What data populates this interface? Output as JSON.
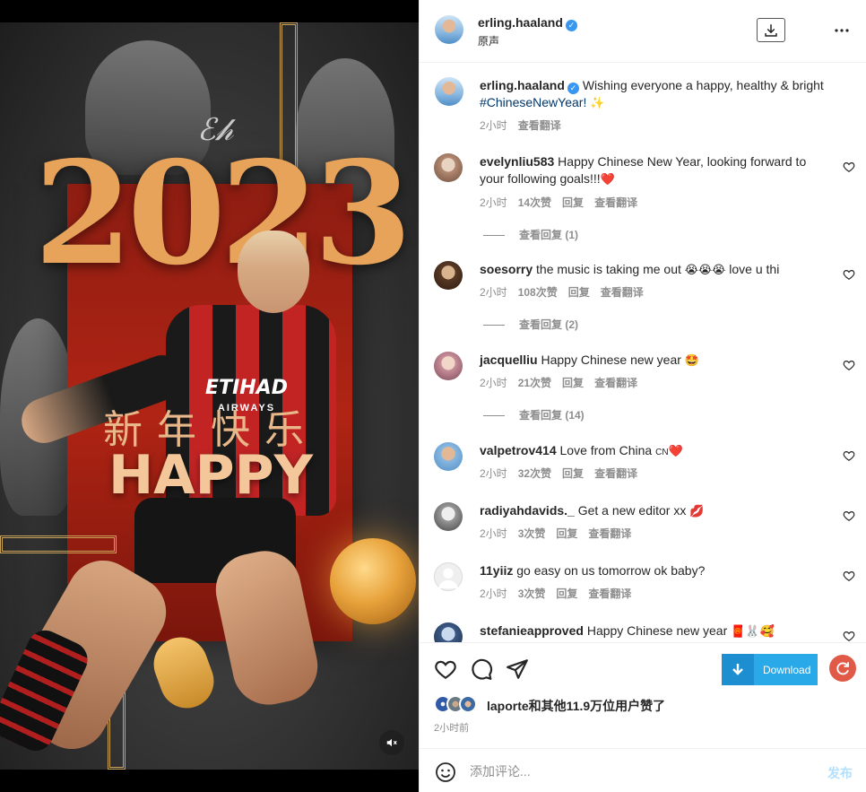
{
  "media": {
    "year_text": "2023",
    "greeting_cn": "新年快乐",
    "greeting_en": "HAPPY",
    "sponsor": "ETIHAD",
    "sponsor_sub": "AIRWAYS",
    "mute_icon": "speaker-muted-icon"
  },
  "header": {
    "username": "erling.haaland",
    "audio_label": "原声",
    "download_icon": "download-tray-icon",
    "more_icon": "more-horizontal-icon"
  },
  "caption": {
    "username": "erling.haaland",
    "text": "Wishing everyone a happy, healthy & bright",
    "hashtag": "#ChineseNewYear!",
    "emoji": "✨",
    "time": "2小时",
    "translate": "查看翻译"
  },
  "comments": [
    {
      "username": "evelynliu583",
      "text": "Happy Chinese New Year, looking forward to your following goals!!!",
      "emoji": "❤️",
      "time": "2小时",
      "likes": "14次赞",
      "reply": "回复",
      "translate": "查看翻译",
      "view_replies": "查看回复 (1)"
    },
    {
      "username": "soesorry",
      "text": "the music is taking me out",
      "emoji": "😭😭😭",
      "text2": "love u thi",
      "time": "2小时",
      "likes": "108次赞",
      "reply": "回复",
      "translate": "查看翻译",
      "view_replies": "查看回复 (2)"
    },
    {
      "username": "jacquelliu",
      "text": "Happy Chinese new year",
      "emoji": "🤩",
      "time": "2小时",
      "likes": "21次赞",
      "reply": "回复",
      "translate": "查看翻译",
      "view_replies": "查看回复 (14)"
    },
    {
      "username": "valpetrov414",
      "text": "Love from China",
      "flag": "CN",
      "emoji": "❤️",
      "time": "2小时",
      "likes": "32次赞",
      "reply": "回复",
      "translate": "查看翻译"
    },
    {
      "username": "radiyahdavids._",
      "text": "Get a new editor xx",
      "emoji": "💋",
      "time": "2小时",
      "likes": "3次赞",
      "reply": "回复",
      "translate": "查看翻译"
    },
    {
      "username": "11yiiz",
      "text": "go easy on us tomorrow ok baby?",
      "time": "2小时",
      "likes": "3次赞",
      "reply": "回复",
      "translate": "查看翻译"
    },
    {
      "username": "stefanieapproved",
      "text": "Happy Chinese new year",
      "emoji": "🧧🐰🥰"
    }
  ],
  "actions": {
    "like_icon": "heart-icon",
    "comment_icon": "comment-bubble-icon",
    "share_icon": "paper-plane-icon",
    "download_label": "Download",
    "refresh_icon": "refresh-icon",
    "likes_text": "laporte和其他11.9万位用户赞了",
    "posted_ago": "2小时前"
  },
  "comment_bar": {
    "emoji_icon": "smiley-icon",
    "placeholder": "添加评论...",
    "post_label": "发布"
  },
  "colors": {
    "verified": "#3897f0",
    "download_button": "#29a9e8",
    "refresh_button": "#e05a47",
    "post_disabled": "#b2dffc"
  }
}
